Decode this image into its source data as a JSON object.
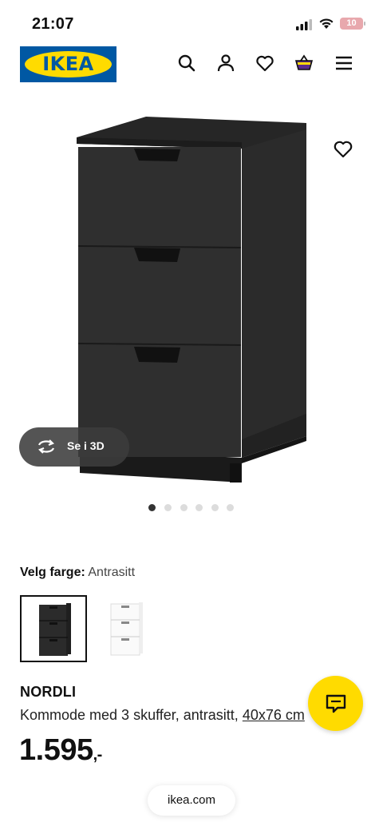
{
  "status_bar": {
    "time": "21:07",
    "battery": "10"
  },
  "brand": {
    "logo_text": "IKEA",
    "colors": {
      "blue": "#0058a3",
      "yellow": "#ffdb00"
    }
  },
  "header": {
    "icons": [
      "search-icon",
      "user-icon",
      "heart-icon",
      "basket-icon",
      "menu-icon"
    ]
  },
  "gallery": {
    "view_3d_label": "Se i 3D",
    "image_count": 6,
    "active_index": 0
  },
  "color_picker": {
    "label": "Velg farge:",
    "selected": "Antrasitt",
    "options": [
      "Antrasitt",
      "Hvit"
    ]
  },
  "product": {
    "name": "NORDLI",
    "description": "Kommode med 3 skuffer, antrasitt,",
    "size_link": "40x76 cm",
    "price": "1.595",
    "price_suffix": ",-"
  },
  "browser": {
    "url": "ikea.com"
  }
}
